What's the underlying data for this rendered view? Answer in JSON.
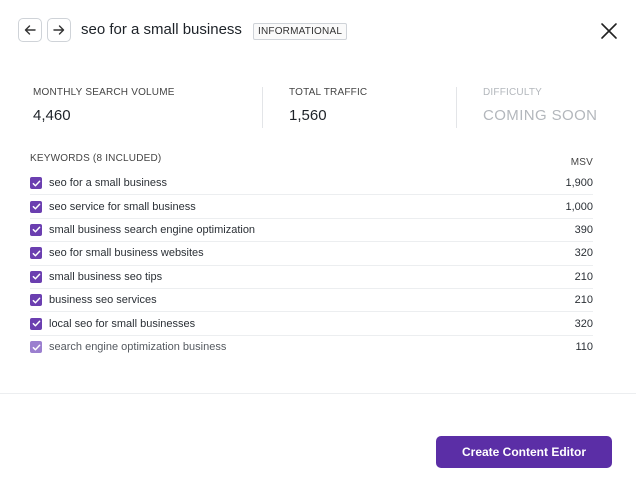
{
  "header": {
    "title": "seo for a small business",
    "intent_badge": "INFORMATIONAL",
    "back_icon": "arrow-left",
    "forward_icon": "arrow-right",
    "close_icon": "close"
  },
  "stats": {
    "monthly_search_volume": {
      "label": "MONTHLY SEARCH VOLUME",
      "value": "4,460"
    },
    "total_traffic": {
      "label": "TOTAL TRAFFIC",
      "value": "1,560"
    },
    "difficulty": {
      "label": "DIFFICULTY",
      "value": "COMING SOON"
    }
  },
  "keywords": {
    "heading": "KEYWORDS (8 INCLUDED)",
    "msv_header": "MSV",
    "items": [
      {
        "keyword": "seo for a small business",
        "msv": "1,900",
        "checked": true
      },
      {
        "keyword": "seo service for small business",
        "msv": "1,000",
        "checked": true
      },
      {
        "keyword": "small business search engine optimization",
        "msv": "390",
        "checked": true
      },
      {
        "keyword": "seo for small business websites",
        "msv": "320",
        "checked": true
      },
      {
        "keyword": "small business seo tips",
        "msv": "210",
        "checked": true
      },
      {
        "keyword": "business seo services",
        "msv": "210",
        "checked": true
      },
      {
        "keyword": "local seo for small businesses",
        "msv": "320",
        "checked": true
      },
      {
        "keyword": "search engine optimization business",
        "msv": "110",
        "checked": true
      }
    ]
  },
  "footer": {
    "cta_label": "Create Content Editor"
  },
  "colors": {
    "accent": "#5b2ea6",
    "checkbox": "#6b3fb0",
    "muted_text": "#b3b7bc"
  }
}
